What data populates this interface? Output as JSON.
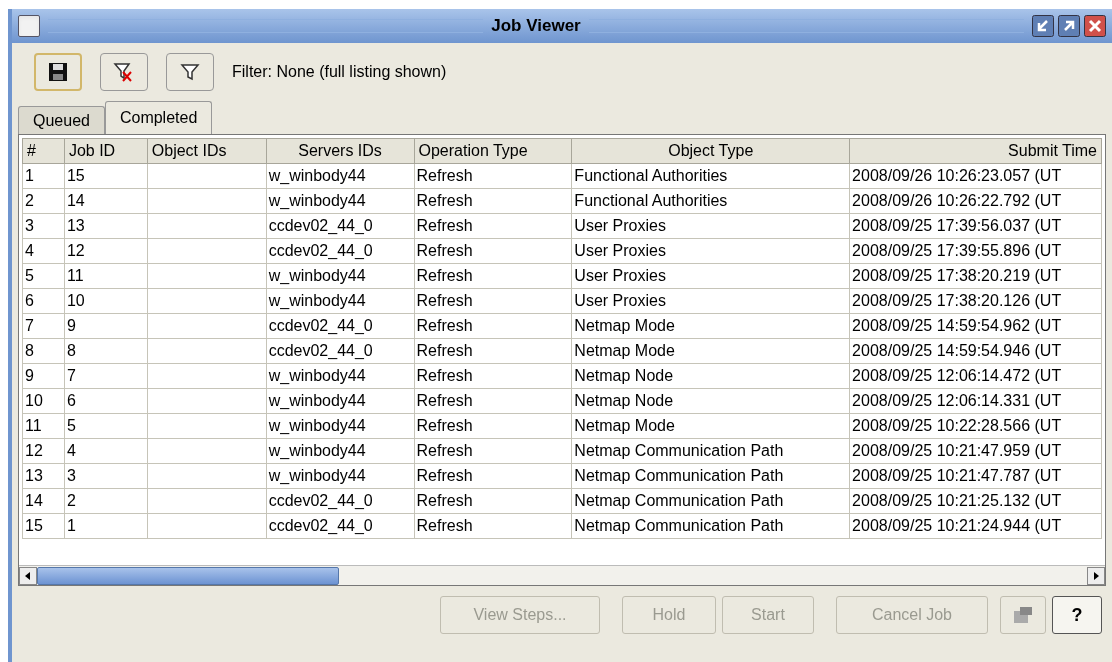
{
  "window": {
    "title": "Job Viewer"
  },
  "toolbar": {
    "filter_label": "Filter: None (full listing shown)"
  },
  "tabs": [
    {
      "label": "Queued",
      "selected": false
    },
    {
      "label": "Completed",
      "selected": true
    }
  ],
  "table": {
    "columns": [
      "#",
      "Job ID",
      "Object IDs",
      "Servers IDs",
      "Operation Type",
      "Object Type",
      "Submit Time"
    ],
    "rows": [
      [
        "1",
        "15",
        "",
        "w_winbody44",
        "Refresh",
        "Functional Authorities",
        "2008/09/26 10:26:23.057 (UT"
      ],
      [
        "2",
        "14",
        "",
        "w_winbody44",
        "Refresh",
        "Functional Authorities",
        "2008/09/26 10:26:22.792 (UT"
      ],
      [
        "3",
        "13",
        "",
        "ccdev02_44_0",
        "Refresh",
        "User Proxies",
        "2008/09/25 17:39:56.037 (UT"
      ],
      [
        "4",
        "12",
        "",
        "ccdev02_44_0",
        "Refresh",
        "User Proxies",
        "2008/09/25 17:39:55.896 (UT"
      ],
      [
        "5",
        "11",
        "",
        "w_winbody44",
        "Refresh",
        "User Proxies",
        "2008/09/25 17:38:20.219 (UT"
      ],
      [
        "6",
        "10",
        "",
        "w_winbody44",
        "Refresh",
        "User Proxies",
        "2008/09/25 17:38:20.126 (UT"
      ],
      [
        "7",
        "9",
        "",
        "ccdev02_44_0",
        "Refresh",
        "Netmap Mode",
        "2008/09/25 14:59:54.962 (UT"
      ],
      [
        "8",
        "8",
        "",
        "ccdev02_44_0",
        "Refresh",
        "Netmap Mode",
        "2008/09/25 14:59:54.946 (UT"
      ],
      [
        "9",
        "7",
        "",
        "w_winbody44",
        "Refresh",
        "Netmap Node",
        "2008/09/25 12:06:14.472 (UT"
      ],
      [
        "10",
        "6",
        "",
        "w_winbody44",
        "Refresh",
        "Netmap Node",
        "2008/09/25 12:06:14.331 (UT"
      ],
      [
        "11",
        "5",
        "",
        "w_winbody44",
        "Refresh",
        "Netmap Mode",
        "2008/09/25 10:22:28.566 (UT"
      ],
      [
        "12",
        "4",
        "",
        "w_winbody44",
        "Refresh",
        "Netmap Communication Path",
        "2008/09/25 10:21:47.959 (UT"
      ],
      [
        "13",
        "3",
        "",
        "w_winbody44",
        "Refresh",
        "Netmap Communication Path",
        "2008/09/25 10:21:47.787 (UT"
      ],
      [
        "14",
        "2",
        "",
        "ccdev02_44_0",
        "Refresh",
        "Netmap Communication Path",
        "2008/09/25 10:21:25.132 (UT"
      ],
      [
        "15",
        "1",
        "",
        "ccdev02_44_0",
        "Refresh",
        "Netmap Communication Path",
        "2008/09/25 10:21:24.944 (UT"
      ]
    ]
  },
  "buttons": [
    {
      "label": "View Steps...",
      "disabled": true
    },
    {
      "label": "Hold",
      "disabled": true
    },
    {
      "label": "Start",
      "disabled": true
    },
    {
      "label": "Cancel Job",
      "disabled": true
    }
  ],
  "help_button": {
    "label": "?",
    "disabled": false
  }
}
